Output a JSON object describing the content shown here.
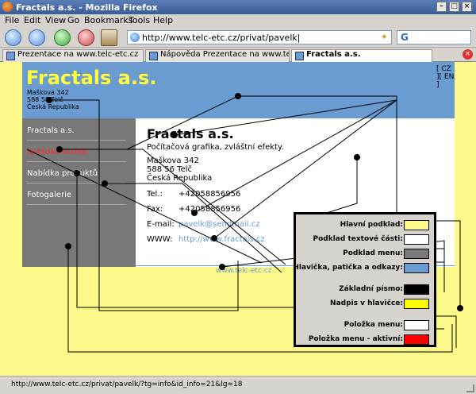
{
  "window": {
    "title": "Fractals a.s. - Mozilla Firefox"
  },
  "menubar": {
    "items": [
      "File",
      "Edit",
      "View",
      "Go",
      "Bookmarks",
      "Tools",
      "Help"
    ]
  },
  "toolbar": {
    "url": "http://www.telc-etc.cz/privat/pavelk|",
    "search_engine_icon": "G",
    "icons": [
      "back-icon",
      "forward-icon",
      "reload-icon",
      "stop-icon",
      "home-icon"
    ]
  },
  "tabs": [
    {
      "label": "Prezentace na www.telc-etc.cz",
      "active": false
    },
    {
      "label": "Nápověda Prezentace na www.telc-e...",
      "active": false
    },
    {
      "label": "Fractals a.s.",
      "active": true
    }
  ],
  "site": {
    "lang_switch": "[ CZ ][ EN ]",
    "header_title": "Fractals a.s.",
    "header_address": [
      "Maškova 342",
      "588 56 Telč",
      "Česká Republika"
    ],
    "menu": [
      {
        "label": "Fractals a.s.",
        "active": false
      },
      {
        "label": "Nabídka služeb",
        "active": true
      },
      {
        "label": "Nabídka produktů",
        "active": false
      },
      {
        "label": "Fotogalerie",
        "active": false
      }
    ],
    "content": {
      "title": "Fractals a.s.",
      "subtitle": "Počítačová grafika, zvláštní efekty.",
      "address": [
        "Maškova 342",
        "588 56 Telč",
        "Česká Republika"
      ],
      "contacts": [
        {
          "label": "Tel.:",
          "value": "+42058856956",
          "link": false
        },
        {
          "label": "Fax:",
          "value": "+42058856956",
          "link": false
        },
        {
          "label": "E-mail:",
          "value": "pavelk@sendmail.cz",
          "link": true
        },
        {
          "label": "WWW:",
          "value": "http://www.fractals.cz",
          "link": true
        }
      ]
    },
    "footer_link": "www.telc-etc.cz"
  },
  "legend": {
    "rows": [
      {
        "label": "Hlavní podklad:",
        "color": "#fbf98a"
      },
      {
        "label": "Podklad textové části:",
        "color": "#ffffff"
      },
      {
        "label": "Podklad menu:",
        "color": "#787878"
      },
      {
        "label": "Hlavička, patička a odkazy:",
        "color": "#6a9bd1"
      },
      {
        "label": "Základní písmo:",
        "color": "#000000"
      },
      {
        "label": "Nadpis v hlavičce:",
        "color": "#ffff00"
      },
      {
        "label": "Položka menu:",
        "color": "#ffffff"
      },
      {
        "label": "Položka menu - aktivní:",
        "color": "#ff0000"
      }
    ]
  },
  "statusbar": {
    "text": "http://www.telc-etc.cz/privat/pavelk/?tg=info&id_info=21&lg=18"
  }
}
